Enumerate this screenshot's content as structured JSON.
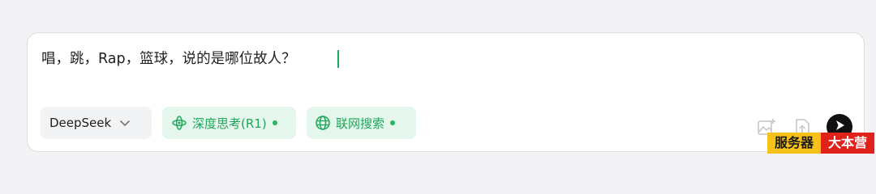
{
  "input": {
    "text": "唱，跳，Rap，篮球，说的是哪位故人？"
  },
  "toolbar": {
    "model_label": "DeepSeek",
    "deep_think_label": "深度思考(R1)",
    "web_search_label": "联网搜索"
  },
  "icons": {
    "model_dropdown": "chevron-down-icon",
    "deep_think": "atom-icon",
    "web_search": "globe-icon",
    "image": "image-icon",
    "upload": "upload-icon",
    "send": "send-icon"
  },
  "watermark": {
    "left": "服务器",
    "right": "大本营"
  },
  "colors": {
    "accent_green": "#1fa75c",
    "chip_green_bg": "#e5f6ec",
    "send_bg": "#111111",
    "caret": "#21a565",
    "watermark_yellow": "#f6c21a",
    "watermark_red": "#e0221b"
  }
}
